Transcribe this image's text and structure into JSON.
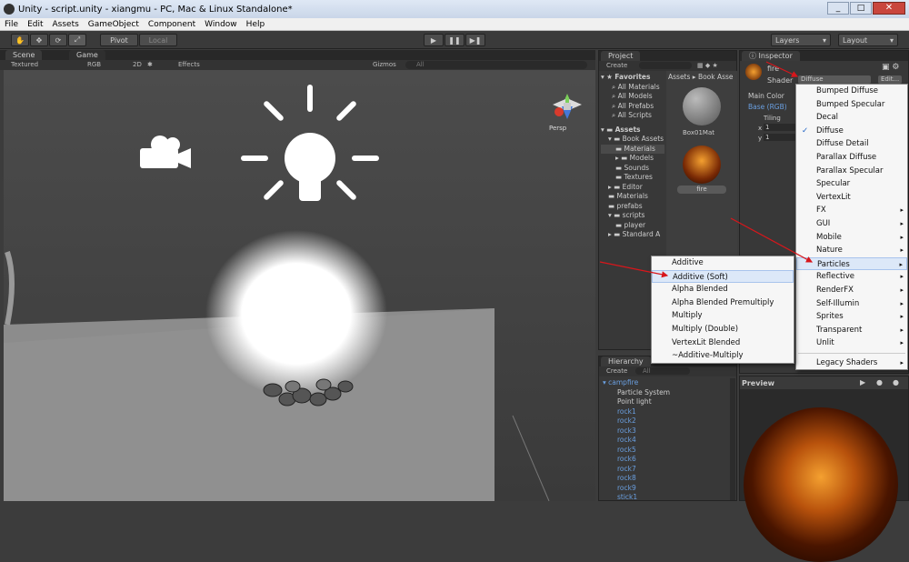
{
  "window": {
    "title": "Unity - script.unity - xiangmu - PC, Mac & Linux Standalone*"
  },
  "menubar": [
    "File",
    "Edit",
    "Assets",
    "GameObject",
    "Component",
    "Window",
    "Help"
  ],
  "toolbar": {
    "pivot": "Pivot",
    "local": "Local",
    "layers": "Layers",
    "layout": "Layout"
  },
  "scene": {
    "tab_scene": "Scene",
    "tab_game": "Game",
    "textured": "Textured",
    "rgb": "RGB",
    "mode_2d": "2D",
    "effects": "Effects",
    "gizmos": "Gizmos",
    "search_placeholder": "All",
    "persp": "Persp"
  },
  "project": {
    "tab": "Project",
    "create": "Create",
    "favorites_label": "Favorites",
    "favorites": [
      "All Materials",
      "All Models",
      "All Prefabs",
      "All Scripts"
    ],
    "assets_label": "Assets",
    "tree": [
      "Book Assets",
      "Materials",
      "Models",
      "Sounds",
      "Textures",
      "Editor",
      "Materials",
      "prefabs",
      "scripts",
      "player",
      "Standard A"
    ],
    "breadcrumb": "Assets ▸ Book Asse",
    "items": [
      {
        "name": "Box01Mat"
      },
      {
        "name": "fire"
      }
    ]
  },
  "hierarchy": {
    "tab": "Hierarchy",
    "create": "Create",
    "search_placeholder": "All",
    "root": "campfire",
    "children": [
      "Particle System",
      "Point light",
      "rock1",
      "rock2",
      "rock3",
      "rock4",
      "rock5",
      "rock6",
      "rock7",
      "rock8",
      "rock9",
      "stick1"
    ]
  },
  "inspector": {
    "tab": "Inspector",
    "name": "fire",
    "shader_label": "Shader",
    "shader_value": "Diffuse",
    "edit": "Edit...",
    "main_color": "Main Color",
    "base": "Base (RGB)",
    "tiling": "Tiling",
    "x_val": "1",
    "y_val": "1"
  },
  "preview": {
    "label": "Preview"
  },
  "shader_menu": [
    {
      "label": "Bumped Diffuse"
    },
    {
      "label": "Bumped Specular"
    },
    {
      "label": "Decal"
    },
    {
      "label": "Diffuse",
      "checked": true
    },
    {
      "label": "Diffuse Detail"
    },
    {
      "label": "Parallax Diffuse"
    },
    {
      "label": "Parallax Specular"
    },
    {
      "label": "Specular"
    },
    {
      "label": "VertexLit"
    },
    {
      "label": "FX",
      "sub": true
    },
    {
      "label": "GUI",
      "sub": true
    },
    {
      "label": "Mobile",
      "sub": true
    },
    {
      "label": "Nature",
      "sub": true
    },
    {
      "label": "Particles",
      "sub": true,
      "selected": true
    },
    {
      "label": "Reflective",
      "sub": true
    },
    {
      "label": "RenderFX",
      "sub": true
    },
    {
      "label": "Self-Illumin",
      "sub": true
    },
    {
      "label": "Sprites",
      "sub": true
    },
    {
      "label": "Transparent",
      "sub": true
    },
    {
      "label": "Unlit",
      "sub": true
    },
    {
      "sep": true
    },
    {
      "label": "Legacy Shaders",
      "sub": true
    }
  ],
  "particles_menu": [
    {
      "label": "Additive"
    },
    {
      "label": "Additive (Soft)",
      "selected": true
    },
    {
      "label": "Alpha Blended"
    },
    {
      "label": "Alpha Blended Premultiply"
    },
    {
      "label": "Multiply"
    },
    {
      "label": "Multiply (Double)"
    },
    {
      "label": "VertexLit Blended"
    },
    {
      "label": "~Additive-Multiply"
    }
  ],
  "colors": {
    "accent": "#6a9fe0",
    "arrow": "#d8161b"
  }
}
